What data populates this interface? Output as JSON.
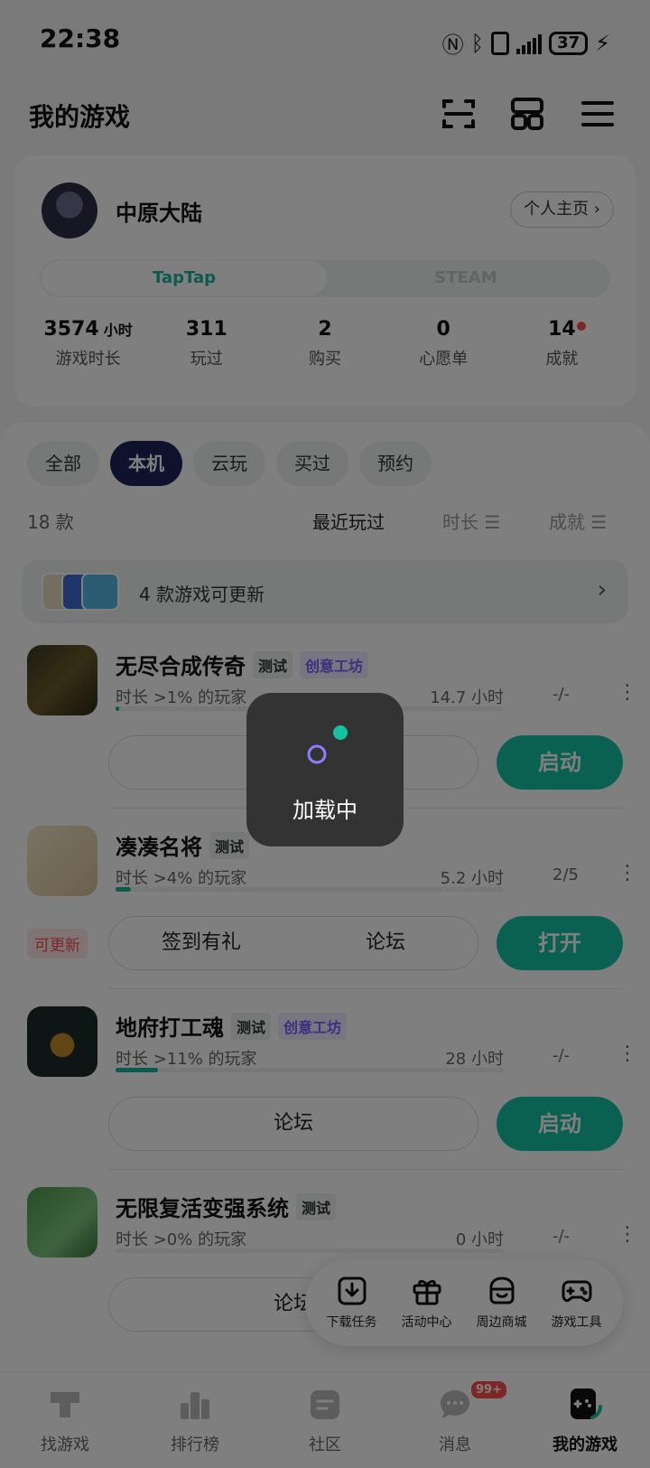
{
  "status": {
    "time": "22:38",
    "battery": "37"
  },
  "header": {
    "title": "我的游戏"
  },
  "profile": {
    "name": "中原大陆",
    "homepage": "个人主页",
    "platform_tabs": [
      "TapTap",
      "STEAM"
    ],
    "stats": [
      {
        "value": "3574",
        "unit": "小时",
        "label": "游戏时长"
      },
      {
        "value": "311",
        "unit": "",
        "label": "玩过"
      },
      {
        "value": "2",
        "unit": "",
        "label": "购买"
      },
      {
        "value": "0",
        "unit": "",
        "label": "心愿单"
      },
      {
        "value": "14",
        "unit": "",
        "label": "成就",
        "dot": true
      }
    ]
  },
  "filters": [
    {
      "label": "全部",
      "active": false
    },
    {
      "label": "本机",
      "active": true
    },
    {
      "label": "云玩",
      "active": false
    },
    {
      "label": "买过",
      "active": false
    },
    {
      "label": "预约",
      "active": false
    }
  ],
  "list": {
    "count": "18 款",
    "sort_recent": "最近玩过",
    "sort_duration": "时长 ☰",
    "sort_achievement": "成就 ☰"
  },
  "update_banner": {
    "text": "4 款游戏可更新"
  },
  "games": [
    {
      "name": "无尽合成传奇",
      "tags": [
        "测试",
        "创意工坊"
      ],
      "players": "时长 >1% 的玩家",
      "hours": "14.7 小时",
      "progress": 0.01,
      "achievement": "-/-",
      "actions": [],
      "launch": "启动",
      "update": ""
    },
    {
      "name": "凑凑名将",
      "tags": [
        "测试"
      ],
      "players": "时长 >4% 的玩家",
      "hours": "5.2 小时",
      "progress": 0.04,
      "achievement": "2/5",
      "actions": [
        "签到有礼",
        "论坛"
      ],
      "launch": "打开",
      "update": "可更新"
    },
    {
      "name": "地府打工魂",
      "tags": [
        "测试",
        "创意工坊"
      ],
      "players": "时长 >11% 的玩家",
      "hours": "28 小时",
      "progress": 0.11,
      "achievement": "-/-",
      "actions": [
        "论坛"
      ],
      "launch": "启动",
      "update": ""
    },
    {
      "name": "无限复活变强系统",
      "tags": [
        "测试"
      ],
      "players": "时长 >0% 的玩家",
      "hours": "0 小时",
      "progress": 0.0,
      "achievement": "-/-",
      "actions": [
        "论坛"
      ],
      "launch": "",
      "update": ""
    }
  ],
  "floatbar": [
    {
      "label": "下载任务",
      "icon": "download-icon"
    },
    {
      "label": "活动中心",
      "icon": "gift-icon"
    },
    {
      "label": "周边商城",
      "icon": "store-icon"
    },
    {
      "label": "游戏工具",
      "icon": "gamepad-icon"
    }
  ],
  "bottomnav": [
    {
      "label": "找游戏",
      "icon": "taptap-icon",
      "active": false
    },
    {
      "label": "排行榜",
      "icon": "ranking-icon",
      "active": false
    },
    {
      "label": "社区",
      "icon": "community-icon",
      "active": false
    },
    {
      "label": "消息",
      "icon": "message-icon",
      "active": false,
      "badge": "99+"
    },
    {
      "label": "我的游戏",
      "icon": "my-games-icon",
      "active": true
    }
  ],
  "loading": {
    "text": "加载中"
  },
  "colors": {
    "accent": "#14c2a3",
    "navy": "#1d2558",
    "purple": "#7d5cff",
    "red": "#ff4d4f"
  }
}
